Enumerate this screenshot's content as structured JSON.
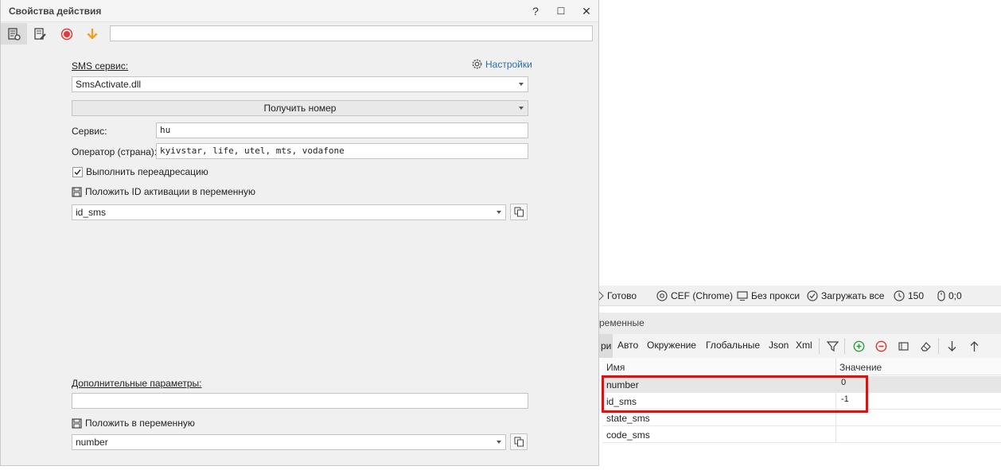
{
  "dialog": {
    "title": "Свойства действия",
    "help": "?",
    "maximize": "☐",
    "close": "✕"
  },
  "form": {
    "sms_service_label": "SMS сервис:",
    "settings_label": "Настройки",
    "sms_service_value": "SmsActivate.dll",
    "action_value": "Получить номер",
    "service_label": "Сервис:",
    "service_value": "hu",
    "operator_label": "Оператор (страна):",
    "operator_value": "kyivstar, life, utel, mts, vodafone",
    "redirect_label": "Выполнить переадресацию",
    "redirect_checked": true,
    "put_id_label": "Положить ID активации в переменную",
    "id_var_value": "id_sms",
    "extra_params_label": "Дополнительные параметры:",
    "extra_params_value": "",
    "put_var_label": "Положить в переменную",
    "put_var_value": "number"
  },
  "statusbar": {
    "ready": "Готово",
    "browser": "CEF (Chrome)",
    "proxy": "Без прокси",
    "load": "Загружать все",
    "timer": "150",
    "coords": "0;0"
  },
  "variables": {
    "panel_title": "ременные",
    "tabs": [
      "ри",
      "Авто",
      "Окружение",
      "Глобальные",
      "Json",
      "Xml"
    ],
    "columns": [
      "Имя",
      "Значение"
    ],
    "rows": [
      {
        "name": "number",
        "value": "0"
      },
      {
        "name": "id_sms",
        "value": "-1"
      },
      {
        "name": "state_sms",
        "value": ""
      },
      {
        "name": "code_sms",
        "value": ""
      }
    ]
  },
  "colors": {
    "highlight": "#e01010",
    "accent": "#2a6fb0"
  }
}
